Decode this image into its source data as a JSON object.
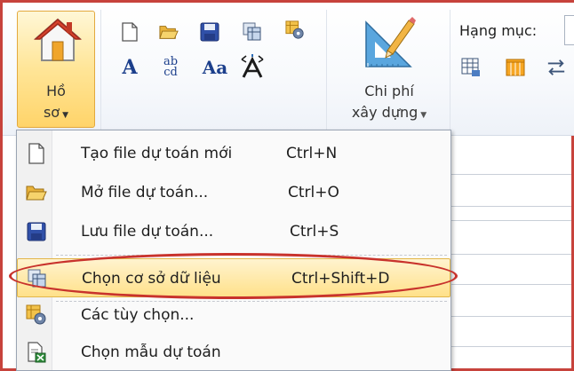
{
  "ribbon": {
    "ho_so_line1": "Hồ",
    "ho_so_line2": "sơ",
    "chi_phi_line1": "Chi phí",
    "chi_phi_line2": "xây dựng",
    "hang_muc_label": "Hạng mục:",
    "quick_icons_row1": [
      "new-file-icon",
      "open-folder-icon",
      "save-disk-icon",
      "database-select-icon",
      "options-gear-icon"
    ],
    "quick_icons_row2": [
      "font-a-icon",
      "ab-cd-icon",
      "font-case-aa-icon",
      "expand-arrows-icon"
    ],
    "font_a": "A",
    "font_aa": "Aa",
    "ab_top": "ab",
    "ab_bottom": "cd"
  },
  "menu": {
    "items": [
      {
        "label": "Tạo file dự toán mới",
        "shortcut": "Ctrl+N",
        "icon": "new-file-icon"
      },
      {
        "label": "Mở file dự toán...",
        "shortcut": "Ctrl+O",
        "icon": "open-folder-icon"
      },
      {
        "label": "Lưu file dự toán...",
        "shortcut": "Ctrl+S",
        "icon": "save-disk-icon"
      },
      {
        "label": "Chọn cơ sở dữ liệu",
        "shortcut": "Ctrl+Shift+D",
        "icon": "database-select-icon"
      },
      {
        "label": "Các tùy chọn...",
        "shortcut": "",
        "icon": "options-gear-icon"
      },
      {
        "label": "Chọn mẫu dự toán",
        "shortcut": "",
        "icon": "template-excel-icon"
      }
    ],
    "selected_index": 3
  },
  "colors": {
    "frame_red": "#c7433c",
    "highlight_ellipse": "#c8322c",
    "selected_bg": "#ffe18a",
    "ho_so_bg": "#ffd46a"
  }
}
